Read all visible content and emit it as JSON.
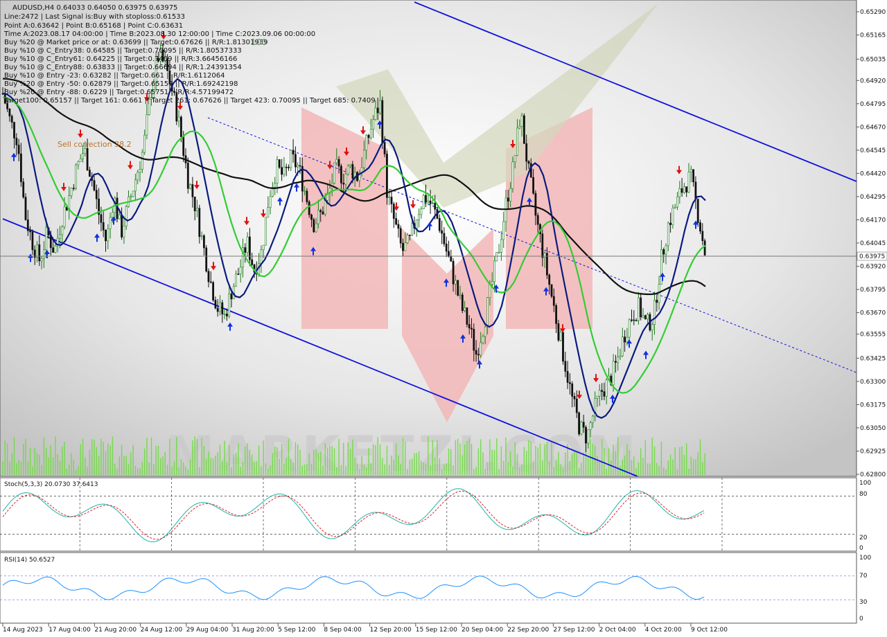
{
  "header": {
    "symbol_line": "AUDUSD,H4  0.64033 0.64050 0.63975 0.63975",
    "info_lines": [
      "Line:2472 | Last Signal is:Buy with stoploss:0.61533",
      "Point A:0.63642 | Point B:0.65168 | Point C:0.63631",
      "Time A:2023.08.17 04:00:00 | Time B:2023.08.30 12:00:00 | Time C:2023.09.06 00:00:00",
      "Buy %20 @ Market price or at: 0.63699 || Target:0.67626 || R/R:1.81301939",
      "Buy %10 @ C_Entry38: 0.64585 || Target:0.70095 || R/R:1.80537333",
      "Buy %10 @ C_Entry61: 0.64225 || Target:0.7409 || R/R:3.66456166",
      "Buy %10 @ C_Entry88: 0.63833 || Target:0.66694 || R/R:1.24391354",
      "Buy %10 @ Entry -23: 0.63282 || Target:0.661 || R/R:1.6112064",
      "Buy %20 @ Entry -50: 0.62879 || Target:0.65157 || R/R:1.69242198",
      "Buy %20 @ Entry -88: 0.6229 || Target:0.65751 || R/R:4.57199472",
      "Target100: 0.65157 || Target 161: 0.661 || Target 261: 0.67626 || Target 423: 0.70095 || Target 685: 0.7409"
    ],
    "badge_100": "100",
    "sell_correction_label": "Sell correction 38.2"
  },
  "current_price_label": "0.63975",
  "stoch_label": "Stoch(5,3,3) 20.0730 37.6413",
  "rsi_label": "RSI(14) 50.6527",
  "stoch_levels": [
    "100",
    "80",
    "20",
    "0"
  ],
  "rsi_levels": [
    "100",
    "70",
    "30",
    "0"
  ],
  "colors": {
    "up_candle": "#1a7a1a",
    "down_candle": "#111111",
    "ma_black": "#111111",
    "ma_navy": "#0a1a80",
    "ma_green": "#33cc33",
    "channel": "#1010dd",
    "volume": "#66dd33",
    "stoch_main": "#20b2aa",
    "stoch_signal": "#dd2222",
    "rsi": "#1e90ff",
    "buy_arrow": "#1030e0",
    "sell_arrow": "#e01010"
  },
  "chart_data": [
    {
      "type": "candlestick",
      "title": "AUDUSD,H4",
      "yticks": [
        "0.65290",
        "0.65165",
        "0.65035",
        "0.64920",
        "0.64795",
        "0.64670",
        "0.64545",
        "0.64420",
        "0.64295",
        "0.64170",
        "0.64045",
        "0.63920",
        "0.63795",
        "0.63670",
        "0.63555",
        "0.63425",
        "0.63300",
        "0.63175",
        "0.63050",
        "0.62925",
        "0.62800"
      ],
      "ylim": [
        0.628,
        0.6535
      ],
      "xticks": [
        "14 Aug 2023",
        "17 Aug 04:00",
        "21 Aug 20:00",
        "24 Aug 12:00",
        "29 Aug 04:00",
        "31 Aug 20:00",
        "5 Sep 12:00",
        "8 Sep 04:00",
        "12 Sep 20:00",
        "15 Sep 12:00",
        "20 Sep 04:00",
        "22 Sep 20:00",
        "27 Sep 12:00",
        "2 Oct 04:00",
        "4 Oct 20:00",
        "9 Oct 12:00"
      ],
      "close_path": [
        0.6485,
        0.647,
        0.646,
        0.642,
        0.6405,
        0.6395,
        0.641,
        0.64,
        0.6418,
        0.643,
        0.6445,
        0.6455,
        0.644,
        0.642,
        0.6405,
        0.643,
        0.641,
        0.6425,
        0.644,
        0.6455,
        0.6485,
        0.6505,
        0.65,
        0.6485,
        0.6465,
        0.644,
        0.6425,
        0.6405,
        0.6385,
        0.637,
        0.6365,
        0.638,
        0.639,
        0.6405,
        0.639,
        0.64,
        0.643,
        0.6445,
        0.644,
        0.645,
        0.6445,
        0.643,
        0.6415,
        0.642,
        0.643,
        0.6445,
        0.644,
        0.6445,
        0.644,
        0.6455,
        0.647,
        0.648,
        0.643,
        0.6415,
        0.64,
        0.6405,
        0.642,
        0.643,
        0.6425,
        0.6415,
        0.64,
        0.6385,
        0.637,
        0.636,
        0.6345,
        0.636,
        0.638,
        0.64,
        0.6425,
        0.6445,
        0.6475,
        0.6445,
        0.642,
        0.64,
        0.638,
        0.636,
        0.634,
        0.632,
        0.6305,
        0.63,
        0.6315,
        0.6325,
        0.633,
        0.634,
        0.6355,
        0.6365,
        0.637,
        0.636,
        0.6365,
        0.6395,
        0.6415,
        0.6425,
        0.6435,
        0.644,
        0.642,
        0.6398
      ],
      "volume_relative": "fluctuating, generally 0.1–1.0 of panel height",
      "moving_averages": [
        "black (slow)",
        "navy (medium)",
        "green (fast)"
      ],
      "channel": "descending parallel channel (blue)",
      "current_price": 0.63975
    },
    {
      "type": "line",
      "title": "Stoch(5,3,3)",
      "series": [
        {
          "name": "main",
          "values": [
            20.073
          ]
        },
        {
          "name": "signal",
          "values": [
            37.6413
          ]
        }
      ],
      "ylim": [
        0,
        100
      ],
      "levels": [
        20,
        80
      ]
    },
    {
      "type": "line",
      "title": "RSI(14)",
      "series": [
        {
          "name": "RSI",
          "values": [
            50.6527
          ]
        }
      ],
      "ylim": [
        0,
        100
      ],
      "levels": [
        30,
        70
      ]
    }
  ]
}
